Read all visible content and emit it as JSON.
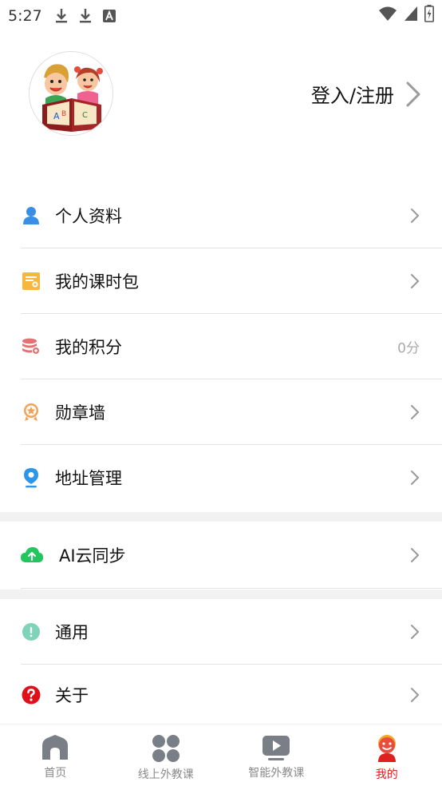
{
  "status": {
    "time": "5:27"
  },
  "profile": {
    "login_label": "登入/注册"
  },
  "menu_group1": [
    {
      "label": "个人资料",
      "icon": "user-icon",
      "value": ""
    },
    {
      "label": "我的课时包",
      "icon": "lesson-package-icon",
      "value": ""
    },
    {
      "label": "我的积分",
      "icon": "points-icon",
      "value": "0分"
    },
    {
      "label": "勋章墙",
      "icon": "medal-icon",
      "value": ""
    },
    {
      "label": "地址管理",
      "icon": "location-icon",
      "value": ""
    }
  ],
  "menu_group2": [
    {
      "label": "AI云同步",
      "icon": "cloud-upload-icon"
    }
  ],
  "menu_group3": [
    {
      "label": "通用",
      "icon": "info-icon"
    },
    {
      "label": "关于",
      "icon": "help-icon"
    }
  ],
  "tabbar": [
    {
      "label": "首页",
      "icon": "home-icon",
      "active": false
    },
    {
      "label": "线上外教课",
      "icon": "grid-icon",
      "active": false
    },
    {
      "label": "智能外教课",
      "icon": "play-icon",
      "active": false
    },
    {
      "label": "我的",
      "icon": "profile-icon",
      "active": true
    }
  ],
  "colors": {
    "accent": "#e02020",
    "user_icon": "#3a8ee6",
    "package_icon": "#f5b83d",
    "points_icon": "#e27373",
    "medal_icon": "#f0a35a",
    "location_icon": "#2d96e8",
    "cloud_icon": "#22c55e",
    "info_icon": "#7fd3b8",
    "help_icon": "#e0101a"
  }
}
